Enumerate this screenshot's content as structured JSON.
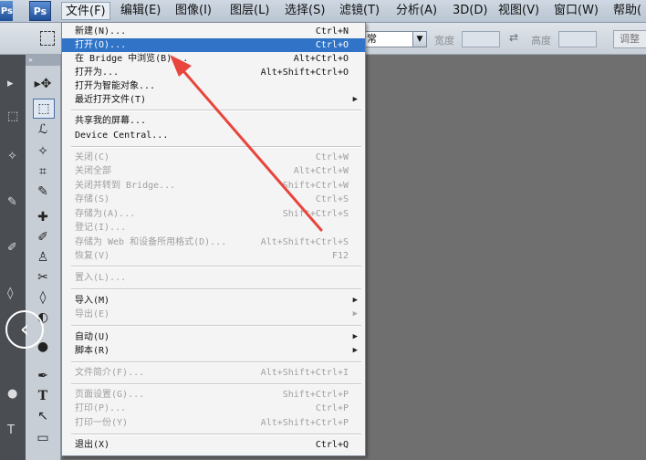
{
  "app": {
    "logo": "Ps",
    "partial_logo": "Ps"
  },
  "menubar": {
    "items": [
      {
        "label": "文件(F)",
        "active": true
      },
      {
        "label": "编辑(E)"
      },
      {
        "label": "图像(I)"
      },
      {
        "label": "图层(L)"
      },
      {
        "label": "选择(S)"
      },
      {
        "label": "滤镜(T)"
      },
      {
        "label": "分析(A)"
      },
      {
        "label": "3D(D)"
      },
      {
        "label": "视图(V)"
      },
      {
        "label": "窗口(W)"
      },
      {
        "label": "帮助("
      }
    ]
  },
  "options": {
    "style_value": "常",
    "width_label": "宽度",
    "height_label": "高度",
    "adjust_button": "调整"
  },
  "file_menu": {
    "items": [
      {
        "label": "新建(N)...",
        "shortcut": "Ctrl+N"
      },
      {
        "label": "打开(O)...",
        "shortcut": "Ctrl+O",
        "highlighted": true
      },
      {
        "label": "在 Bridge 中浏览(B)...",
        "shortcut": "Alt+Ctrl+O"
      },
      {
        "label": "打开为...",
        "shortcut": "Alt+Shift+Ctrl+O"
      },
      {
        "label": "打开为智能对象..."
      },
      {
        "label": "最近打开文件(T)",
        "submenu": true
      },
      {
        "label": "共享我的屏幕..."
      },
      {
        "label": "Device Central..."
      },
      {
        "label": "关闭(C)",
        "shortcut": "Ctrl+W",
        "disabled": true
      },
      {
        "label": "关闭全部",
        "shortcut": "Alt+Ctrl+W",
        "disabled": true
      },
      {
        "label": "关闭并转到 Bridge...",
        "shortcut": "Shift+Ctrl+W",
        "disabled": true
      },
      {
        "label": "存储(S)",
        "shortcut": "Ctrl+S",
        "disabled": true
      },
      {
        "label": "存储为(A)...",
        "shortcut": "Shift+Ctrl+S",
        "disabled": true
      },
      {
        "label": "登记(I)...",
        "disabled": true
      },
      {
        "label": "存储为 Web 和设备所用格式(D)...",
        "shortcut": "Alt+Shift+Ctrl+S",
        "disabled": true
      },
      {
        "label": "恢复(V)",
        "shortcut": "F12",
        "disabled": true
      },
      {
        "label": "置入(L)...",
        "disabled": true
      },
      {
        "label": "导入(M)",
        "submenu": true
      },
      {
        "label": "导出(E)",
        "submenu": true,
        "disabled": true
      },
      {
        "label": "自动(U)",
        "submenu": true
      },
      {
        "label": "脚本(R)",
        "submenu": true
      },
      {
        "label": "文件简介(F)...",
        "shortcut": "Alt+Shift+Ctrl+I",
        "disabled": true
      },
      {
        "label": "页面设置(G)...",
        "shortcut": "Shift+Ctrl+P",
        "disabled": true
      },
      {
        "label": "打印(P)...",
        "shortcut": "Ctrl+P",
        "disabled": true
      },
      {
        "label": "打印一份(Y)",
        "shortcut": "Alt+Shift+Ctrl+P",
        "disabled": true
      },
      {
        "label": "退出(X)",
        "shortcut": "Ctrl+Q"
      }
    ]
  },
  "tools": {
    "glyphs": [
      "▸✥",
      "⬚",
      "ℒ",
      "✧",
      "⌗",
      "✎",
      "✚",
      "✐",
      "♙",
      "✂",
      "◊",
      "◐",
      "●",
      "✒",
      "T",
      "↖",
      "▭"
    ]
  },
  "colors": {
    "highlight": "#3174c7",
    "annotation_arrow": "#e8453c"
  }
}
